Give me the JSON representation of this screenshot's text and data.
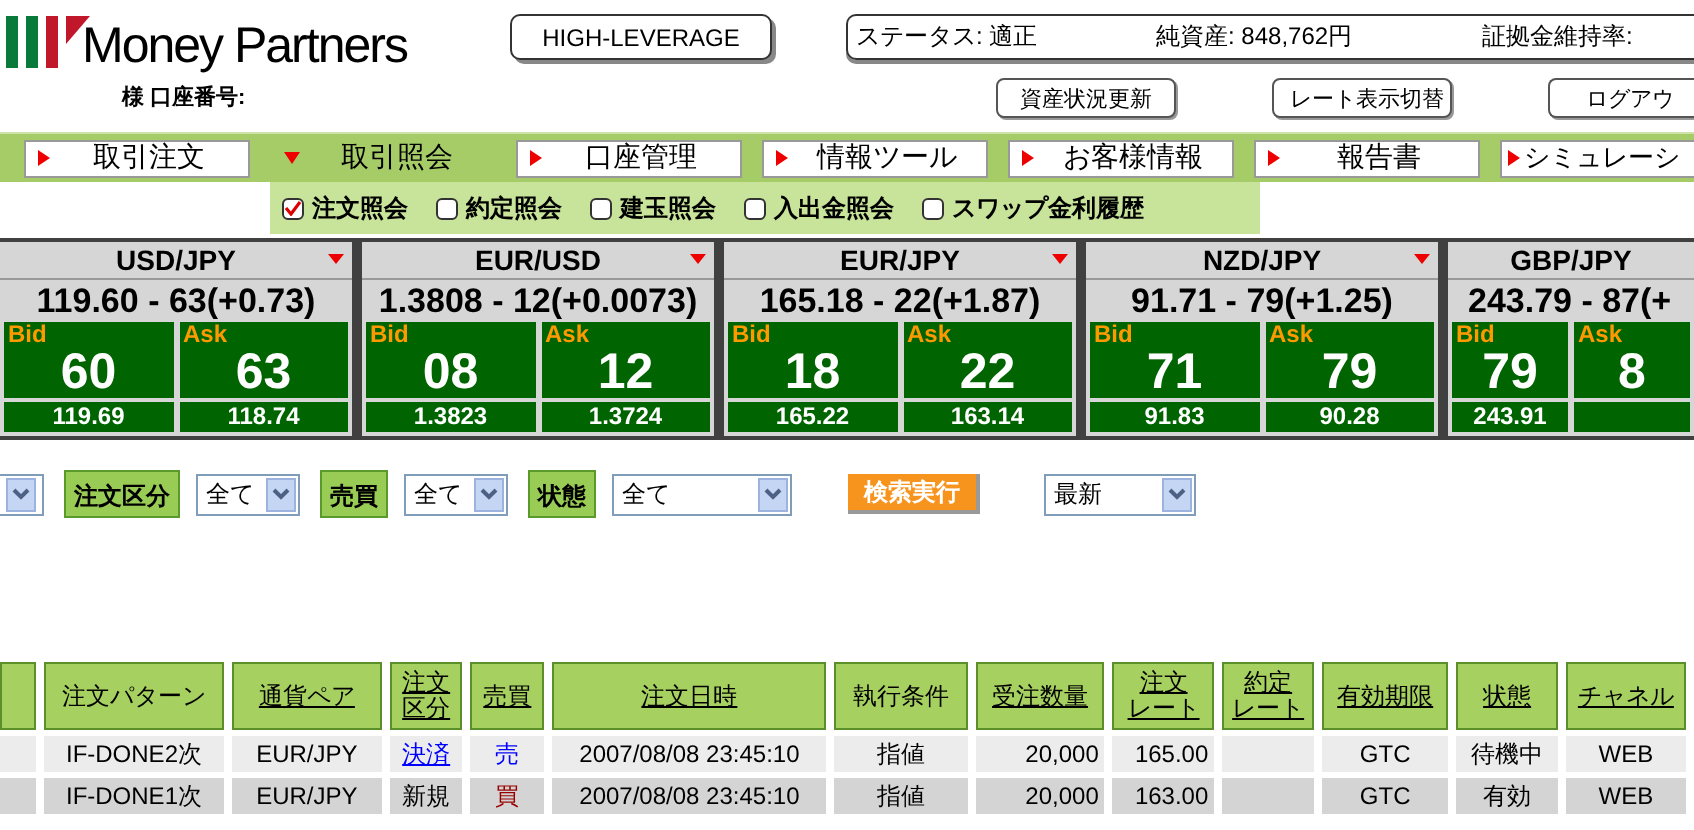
{
  "logo": {
    "brand": "Money Partners",
    "account": "様 口座番号:"
  },
  "leverage_button": "HIGH-LEVERAGE",
  "status_items": [
    {
      "text": "ステータス: 適正"
    },
    {
      "text": "純資産: 848,762円"
    },
    {
      "text": "証拠金維持率:"
    }
  ],
  "header_buttons": [
    "資産状況更新",
    "レート表示切替",
    "ログアウ"
  ],
  "tabs": [
    {
      "label": "取引注文",
      "selected": false
    },
    {
      "label": "取引照会",
      "selected": true
    },
    {
      "label": "口座管理",
      "selected": false
    },
    {
      "label": "情報ツール",
      "selected": false
    },
    {
      "label": "お客様情報",
      "selected": false
    },
    {
      "label": "報告書",
      "selected": false
    },
    {
      "label": "シミュレーシ",
      "selected": false
    }
  ],
  "subtabs": [
    {
      "label": "注文照会",
      "checked": true
    },
    {
      "label": "約定照会",
      "checked": false
    },
    {
      "label": "建玉照会",
      "checked": false
    },
    {
      "label": "入出金照会",
      "checked": false
    },
    {
      "label": "スワップ金利履歴",
      "checked": false
    }
  ],
  "rates": [
    {
      "pair": "USD/JPY",
      "menu": true,
      "quote": "119.60 - 63(+0.73)",
      "bid_label": "Bid",
      "bid": "60",
      "ask_label": "Ask",
      "ask": "63",
      "bid_rate": "119.69",
      "ask_rate": "118.74"
    },
    {
      "pair": "EUR/USD",
      "menu": true,
      "quote": "1.3808 - 12(+0.0073)",
      "bid_label": "Bid",
      "bid": "08",
      "ask_label": "Ask",
      "ask": "12",
      "bid_rate": "1.3823",
      "ask_rate": "1.3724"
    },
    {
      "pair": "EUR/JPY",
      "menu": true,
      "quote": "165.18 - 22(+1.87)",
      "bid_label": "Bid",
      "bid": "18",
      "ask_label": "Ask",
      "ask": "22",
      "bid_rate": "165.22",
      "ask_rate": "163.14"
    },
    {
      "pair": "NZD/JPY",
      "menu": true,
      "quote": "91.71 - 79(+1.25)",
      "bid_label": "Bid",
      "bid": "71",
      "ask_label": "Ask",
      "ask": "79",
      "bid_rate": "91.83",
      "ask_rate": "90.28"
    },
    {
      "pair": "GBP/JPY",
      "menu": false,
      "quote": "243.79 - 87(+",
      "bid_label": "Bid",
      "bid": "79",
      "ask_label": "Ask",
      "ask": "8",
      "bid_rate": "243.91"
    }
  ],
  "filters": [
    {
      "kind": "select"
    },
    {
      "kind": "label",
      "text": "注文区分"
    },
    {
      "kind": "select",
      "value": "全て"
    },
    {
      "kind": "label",
      "text": "売買"
    },
    {
      "kind": "select",
      "value": "全て"
    },
    {
      "kind": "label",
      "text": "状態"
    },
    {
      "kind": "select",
      "value": "全て",
      "wide": true
    },
    {
      "kind": "button",
      "text": "検索実行"
    },
    {
      "kind": "select",
      "value": "最新"
    }
  ],
  "table": {
    "columns": [
      {},
      {
        "lines": [
          "注文パターン"
        ],
        "sortable": false
      },
      {
        "lines": [
          "通貨ペア"
        ],
        "sortable": true
      },
      {
        "lines": [
          "注文",
          "区分"
        ],
        "sortable": true
      },
      {
        "lines": [
          "売買"
        ],
        "sortable": true
      },
      {
        "lines": [
          "注文日時"
        ],
        "sortable": true
      },
      {
        "lines": [
          "執行条件"
        ],
        "sortable": false
      },
      {
        "lines": [
          "受注数量"
        ],
        "sortable": true
      },
      {
        "lines": [
          "注文",
          "レート"
        ],
        "sortable": true
      },
      {
        "lines": [
          "約定",
          "レート"
        ],
        "sortable": true
      },
      {
        "lines": [
          "有効期限"
        ],
        "sortable": true
      },
      {
        "lines": [
          "状態"
        ],
        "sortable": true
      },
      {
        "lines": [
          "チャネル"
        ],
        "sortable": true
      }
    ],
    "rows": [
      {
        "cells": [
          {},
          {
            "text": "IF-DONE2次"
          },
          {
            "text": "EUR/JPY"
          },
          {
            "text": "決済",
            "link": true
          },
          {
            "text": "売",
            "color": "#0000ff"
          },
          {
            "text": "2007/08/08 23:45:10"
          },
          {
            "text": "指値"
          },
          {
            "text": "20,000",
            "right_aligned": true
          },
          {
            "text": "165.00",
            "right_aligned": true
          },
          {},
          {
            "text": "GTC"
          },
          {
            "text": "待機中"
          },
          {
            "text": "WEB"
          }
        ]
      },
      {
        "cells": [
          {},
          {
            "text": "IF-DONE1次"
          },
          {
            "text": "EUR/JPY"
          },
          {
            "text": "新規"
          },
          {
            "text": "買",
            "color": "#990000"
          },
          {
            "text": "2007/08/08 23:45:10"
          },
          {
            "text": "指値"
          },
          {
            "text": "20,000",
            "right_aligned": true
          },
          {
            "text": "163.00",
            "right_aligned": true
          },
          {},
          {
            "text": "GTC"
          },
          {
            "text": "有効"
          },
          {
            "text": "WEB"
          }
        ]
      }
    ]
  }
}
